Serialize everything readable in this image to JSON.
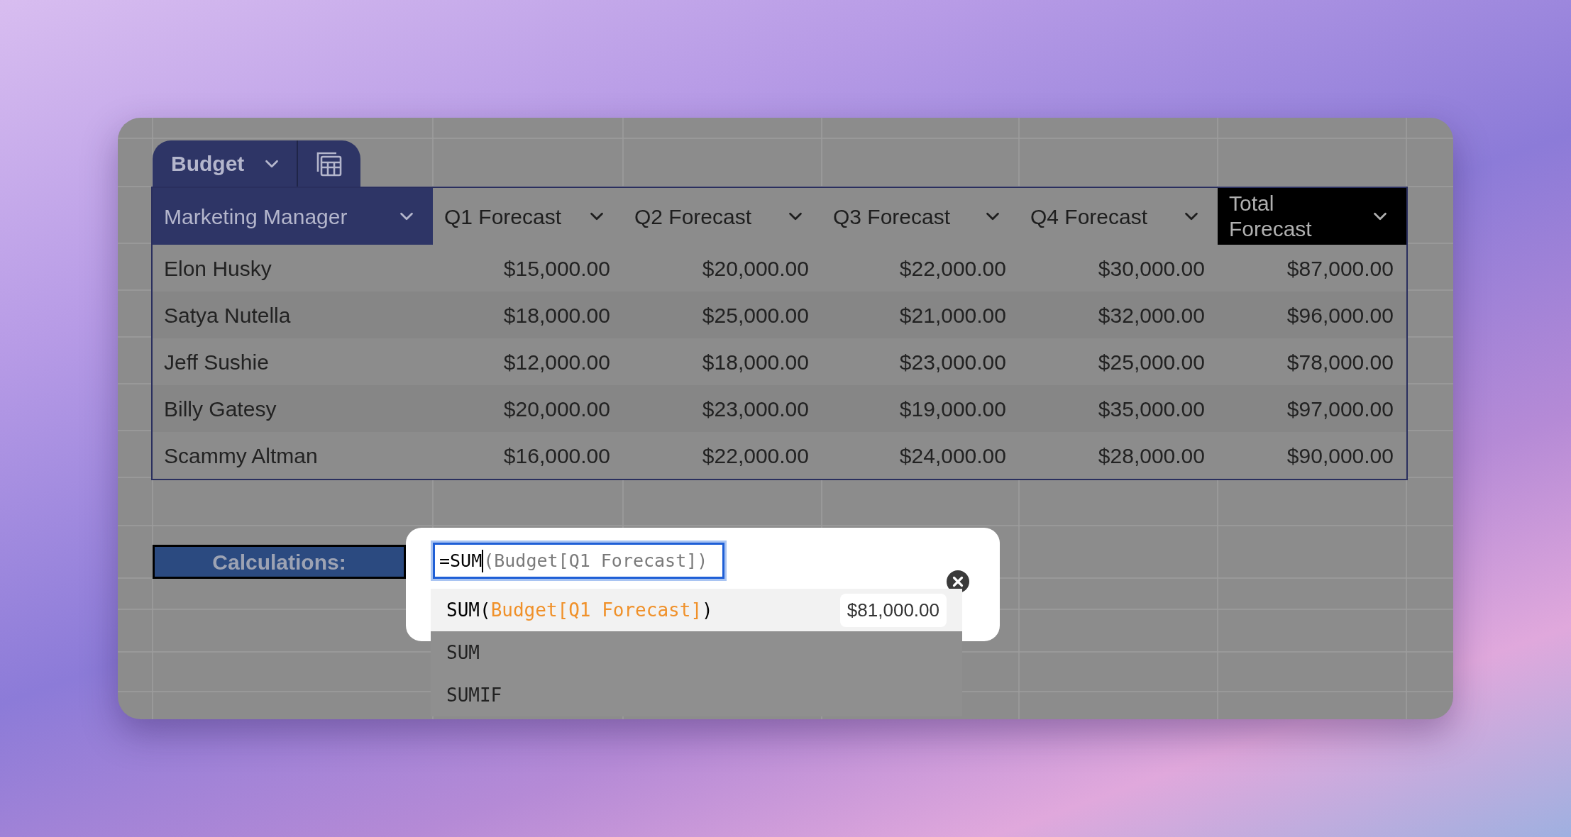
{
  "tab": {
    "label": "Budget"
  },
  "table": {
    "columns": [
      {
        "label": "Marketing Manager",
        "kind": "key"
      },
      {
        "label": "Q1 Forecast",
        "kind": "value"
      },
      {
        "label": "Q2 Forecast",
        "kind": "value"
      },
      {
        "label": "Q3 Forecast",
        "kind": "value"
      },
      {
        "label": "Q4 Forecast",
        "kind": "value"
      },
      {
        "label": "Total Forecast",
        "kind": "total"
      }
    ],
    "rows": [
      [
        "Elon Husky",
        "$15,000.00",
        "$20,000.00",
        "$22,000.00",
        "$30,000.00",
        "$87,000.00"
      ],
      [
        "Satya Nutella",
        "$18,000.00",
        "$25,000.00",
        "$21,000.00",
        "$32,000.00",
        "$96,000.00"
      ],
      [
        "Jeff Sushie",
        "$12,000.00",
        "$18,000.00",
        "$23,000.00",
        "$25,000.00",
        "$78,000.00"
      ],
      [
        "Billy Gatesy",
        "$20,000.00",
        "$23,000.00",
        "$19,000.00",
        "$35,000.00",
        "$97,000.00"
      ],
      [
        "Scammy Altman",
        "$16,000.00",
        "$22,000.00",
        "$24,000.00",
        "$28,000.00",
        "$90,000.00"
      ]
    ]
  },
  "calculation": {
    "label": "Calculations:"
  },
  "formula": {
    "typed": "=SUM",
    "completion_hint": "(Budget[Q1 Forecast])"
  },
  "suggestions": [
    {
      "kind": "expression",
      "function": "SUM(",
      "argument": "Budget[Q1 Forecast]",
      "close": ")",
      "result": "$81,000.00",
      "selected": true
    },
    {
      "kind": "name",
      "label": "SUM",
      "selected": false
    },
    {
      "kind": "name",
      "label": "SUMIF",
      "selected": false
    }
  ]
}
